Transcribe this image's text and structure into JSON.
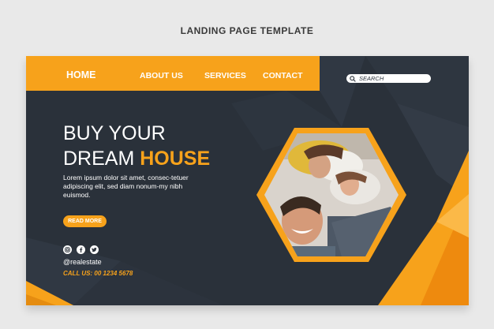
{
  "caption": "LANDING PAGE TEMPLATE",
  "nav": {
    "home": "HOME",
    "about": "ABOUT US",
    "services": "SERVICES",
    "contact": "CONTACT"
  },
  "search": {
    "placeholder": "SEARCH",
    "icon": "search-icon"
  },
  "hero": {
    "line1": "BUY YOUR",
    "line2_prefix": "DREAM",
    "line2_accent": "HOUSE",
    "body": "Lorem ipsum dolor sit amet, consec-tetuer adipiscing elit, sed diam nonum-my nibh euismod.",
    "cta": "READ MORE"
  },
  "social": {
    "icons": [
      "instagram-icon",
      "facebook-icon",
      "twitter-icon"
    ],
    "handle": "@realestate",
    "phone": "CALL US: 00 1234 5678"
  },
  "colors": {
    "accent": "#f7a21b",
    "background": "#2a313a",
    "page": "#e9e9e9"
  }
}
